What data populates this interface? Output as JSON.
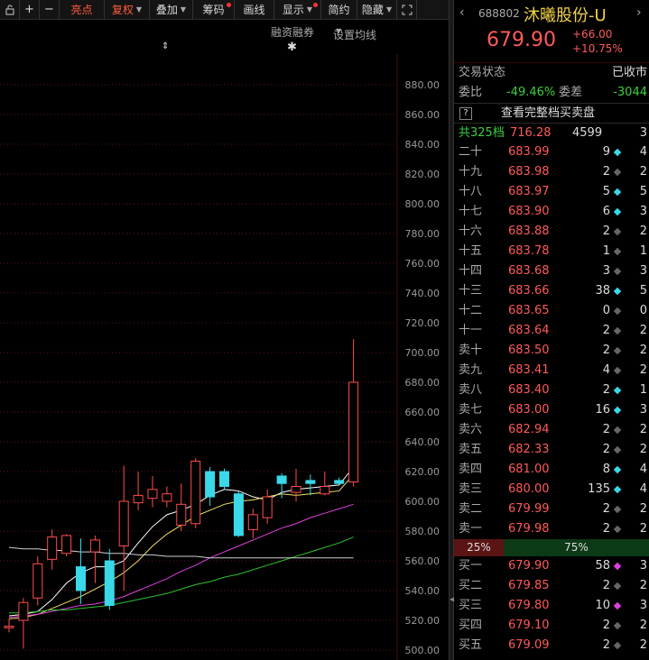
{
  "toolbar": {
    "buttons": [
      {
        "label": "亮点",
        "active": true
      },
      {
        "label": "复权",
        "active": true
      },
      {
        "label": "叠加"
      },
      {
        "label": "筹码"
      },
      {
        "label": "画线"
      },
      {
        "label": "显示"
      },
      {
        "label": "简约"
      },
      {
        "label": "隐藏"
      }
    ]
  },
  "subbar": {
    "margin_label": "融资融券",
    "ma_settings_label": "设置均线"
  },
  "y_axis": {
    "ticks": [
      "880.00",
      "860.00",
      "840.00",
      "820.00",
      "800.00",
      "780.00",
      "760.00",
      "740.00",
      "720.00",
      "700.00",
      "680.00",
      "660.00",
      "640.00",
      "620.00",
      "600.00",
      "580.00",
      "560.00",
      "540.00",
      "520.00",
      "500.00"
    ]
  },
  "chart_data": {
    "type": "candlestick",
    "ylim": [
      500,
      880
    ],
    "candles": [
      {
        "o": 515,
        "c": 516,
        "h": 521,
        "l": 512
      },
      {
        "o": 520,
        "c": 532,
        "h": 535,
        "l": 501
      },
      {
        "o": 535,
        "c": 558,
        "h": 563,
        "l": 530
      },
      {
        "o": 561,
        "c": 576,
        "h": 581,
        "l": 554
      },
      {
        "o": 565,
        "c": 577,
        "h": 578,
        "l": 563
      },
      {
        "o": 556,
        "c": 540,
        "h": 575,
        "l": 531
      },
      {
        "o": 566,
        "c": 574,
        "h": 577,
        "l": 545
      },
      {
        "o": 560,
        "c": 530,
        "h": 568,
        "l": 527
      },
      {
        "o": 570,
        "c": 600,
        "h": 624,
        "l": 540
      },
      {
        "o": 599,
        "c": 604,
        "h": 620,
        "l": 594
      },
      {
        "o": 602,
        "c": 608,
        "h": 617,
        "l": 596
      },
      {
        "o": 600,
        "c": 605,
        "h": 610,
        "l": 596
      },
      {
        "o": 584,
        "c": 598,
        "h": 612,
        "l": 580
      },
      {
        "o": 585,
        "c": 627,
        "h": 629,
        "l": 582
      },
      {
        "o": 620,
        "c": 603,
        "h": 623,
        "l": 597
      },
      {
        "o": 620,
        "c": 610,
        "h": 622,
        "l": 608
      },
      {
        "o": 605,
        "c": 577,
        "h": 607,
        "l": 576
      },
      {
        "o": 581,
        "c": 591,
        "h": 595,
        "l": 575
      },
      {
        "o": 589,
        "c": 603,
        "h": 608,
        "l": 585
      },
      {
        "o": 617,
        "c": 612,
        "h": 619,
        "l": 602
      },
      {
        "o": 606,
        "c": 610,
        "h": 622,
        "l": 600
      },
      {
        "o": 614,
        "c": 612,
        "h": 618,
        "l": 604
      },
      {
        "o": 605,
        "c": 610,
        "h": 620,
        "l": 604
      },
      {
        "o": 614,
        "c": 612,
        "h": 616,
        "l": 611
      },
      {
        "o": 613,
        "c": 680,
        "h": 709,
        "l": 610
      }
    ],
    "ma_lines": [
      {
        "color": "#ffffff",
        "values": [
          523,
          524,
          526,
          534,
          545,
          552,
          556,
          556,
          560,
          572,
          583,
          591,
          594,
          598,
          604,
          608,
          607,
          603,
          601,
          606,
          608,
          609,
          610,
          611,
          623
        ]
      },
      {
        "color": "#f0e060",
        "values": [
          521,
          522,
          524,
          528,
          532,
          536,
          541,
          546,
          552,
          560,
          570,
          578,
          584,
          590,
          594,
          598,
          600,
          601,
          603,
          605,
          604,
          605,
          606,
          607,
          618
        ]
      },
      {
        "color": "#e040e0",
        "values": [
          522,
          523,
          524,
          526,
          528,
          530,
          531,
          533,
          536,
          540,
          544,
          548,
          553,
          557,
          562,
          566,
          570,
          574,
          578,
          582,
          585,
          589,
          592,
          595,
          598
        ]
      },
      {
        "color": "#30c030",
        "values": [
          525,
          525,
          526,
          527,
          527,
          528,
          529,
          530,
          532,
          534,
          536,
          538,
          541,
          544,
          546,
          549,
          551,
          554,
          557,
          560,
          563,
          566,
          569,
          572,
          576
        ]
      },
      {
        "color": "#d0d0d0",
        "values": [
          569,
          568,
          568,
          567,
          567,
          566,
          566,
          565,
          565,
          564,
          564,
          563,
          563,
          563,
          562,
          562,
          562,
          562,
          562,
          562,
          562,
          562,
          562,
          562,
          562
        ]
      }
    ]
  },
  "quote": {
    "code": "688802",
    "name": "沐曦股份-U",
    "price": "679.90",
    "change": "+66.00",
    "change_pct": "+10.75%",
    "trade_status_label": "交易状态",
    "trade_status": "已收市",
    "weibi_label": "委比",
    "weibi": "-49.46%",
    "weicha_label": "委差",
    "weicha": "-3044",
    "full_book_label": "查看完整档买卖盘",
    "help_icon": "?",
    "total_levels_label": "共325档",
    "total_price": "716.28",
    "total_vol": "4599",
    "total_cnt": "3",
    "colors": {
      "up": "#ff5a5a",
      "down": "#3ecf3e",
      "name": "#f2d14a"
    }
  },
  "order_book": {
    "asks": [
      {
        "level": "二十",
        "price": "683.99",
        "vol": "9",
        "mark": "cyan",
        "cnt": "4"
      },
      {
        "level": "十九",
        "price": "683.98",
        "vol": "2",
        "mark": "gray",
        "cnt": "2"
      },
      {
        "level": "十八",
        "price": "683.97",
        "vol": "5",
        "mark": "cyan",
        "cnt": "5"
      },
      {
        "level": "十七",
        "price": "683.90",
        "vol": "6",
        "mark": "cyan",
        "cnt": "3"
      },
      {
        "level": "十六",
        "price": "683.88",
        "vol": "2",
        "mark": "gray",
        "cnt": "2"
      },
      {
        "level": "十五",
        "price": "683.78",
        "vol": "1",
        "mark": "gray",
        "cnt": "1"
      },
      {
        "level": "十四",
        "price": "683.68",
        "vol": "3",
        "mark": "gray",
        "cnt": "3"
      },
      {
        "level": "十三",
        "price": "683.66",
        "vol": "38",
        "mark": "cyan",
        "cnt": "5"
      },
      {
        "level": "十二",
        "price": "683.65",
        "vol": "0",
        "mark": "gray",
        "cnt": "0"
      },
      {
        "level": "十一",
        "price": "683.64",
        "vol": "2",
        "mark": "gray",
        "cnt": "2"
      },
      {
        "level": "卖十",
        "price": "683.50",
        "vol": "2",
        "mark": "gray",
        "cnt": "2"
      },
      {
        "level": "卖九",
        "price": "683.41",
        "vol": "4",
        "mark": "gray",
        "cnt": "2"
      },
      {
        "level": "卖八",
        "price": "683.40",
        "vol": "2",
        "mark": "cyan",
        "cnt": "1"
      },
      {
        "level": "卖七",
        "price": "683.00",
        "vol": "16",
        "mark": "cyan",
        "cnt": "3"
      },
      {
        "level": "卖六",
        "price": "682.94",
        "vol": "2",
        "mark": "gray",
        "cnt": "2"
      },
      {
        "level": "卖五",
        "price": "682.33",
        "vol": "2",
        "mark": "gray",
        "cnt": "2"
      },
      {
        "level": "卖四",
        "price": "681.00",
        "vol": "8",
        "mark": "cyan",
        "cnt": "4"
      },
      {
        "level": "卖三",
        "price": "680.00",
        "vol": "135",
        "mark": "cyan",
        "cnt": "4"
      },
      {
        "level": "卖二",
        "price": "679.99",
        "vol": "2",
        "mark": "gray",
        "cnt": "2"
      },
      {
        "level": "卖一",
        "price": "679.98",
        "vol": "2",
        "mark": "gray",
        "cnt": "2"
      }
    ],
    "sell_ratio": "25%",
    "buy_ratio": "75%",
    "bids": [
      {
        "level": "买一",
        "price": "679.90",
        "vol": "58",
        "mark": "mag",
        "cnt": "3"
      },
      {
        "level": "买二",
        "price": "679.85",
        "vol": "2",
        "mark": "gray",
        "cnt": "2"
      },
      {
        "level": "买三",
        "price": "679.80",
        "vol": "10",
        "mark": "mag",
        "cnt": "3"
      },
      {
        "level": "买四",
        "price": "679.10",
        "vol": "2",
        "mark": "gray",
        "cnt": "2"
      },
      {
        "level": "买五",
        "price": "679.09",
        "vol": "2",
        "mark": "gray",
        "cnt": "2"
      }
    ]
  }
}
